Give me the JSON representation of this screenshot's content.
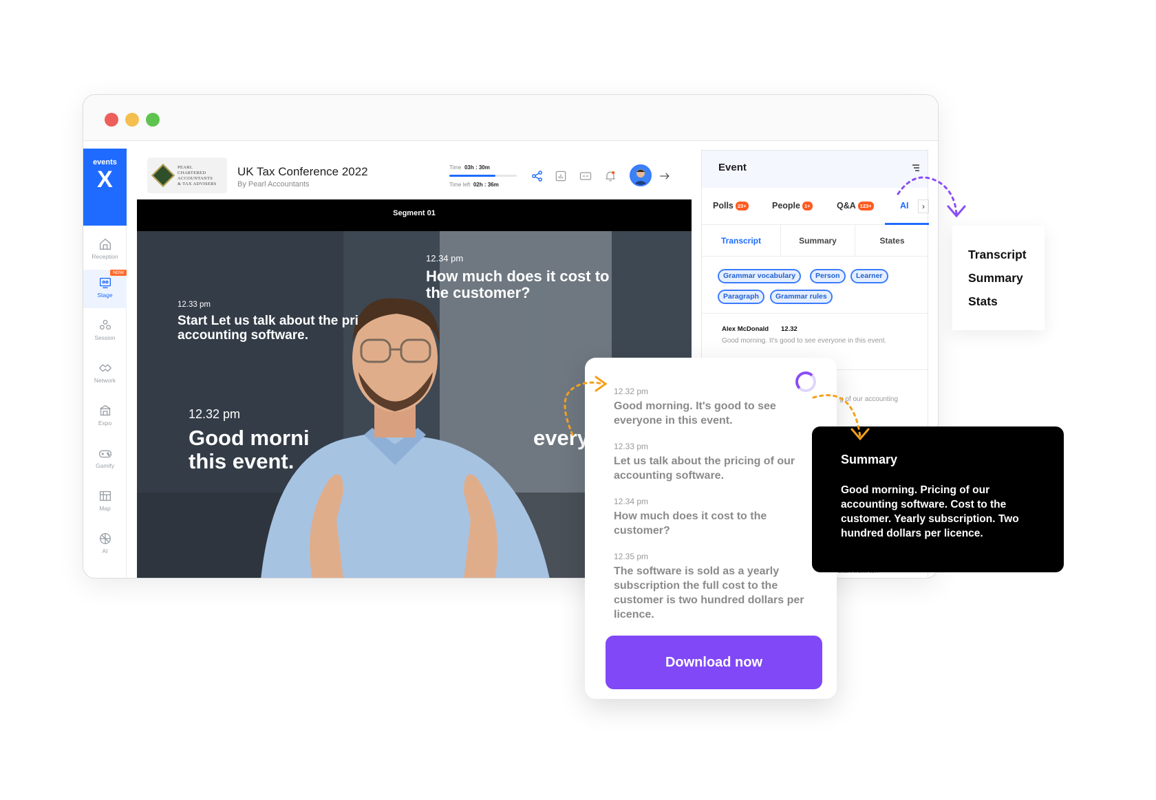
{
  "window": {
    "traffic_lights": [
      "close",
      "minimize",
      "zoom"
    ]
  },
  "sidebar": {
    "brand_word": "events",
    "brand_mark": "X",
    "items": [
      {
        "label": "Reception",
        "icon": "home-icon"
      },
      {
        "label": "Stage",
        "icon": "stage-icon",
        "badge": "NOW",
        "active": true
      },
      {
        "label": "Session",
        "icon": "session-icon"
      },
      {
        "label": "Network",
        "icon": "network-icon"
      },
      {
        "label": "Expo",
        "icon": "expo-icon"
      },
      {
        "label": "Gamify",
        "icon": "gamify-icon"
      },
      {
        "label": "Map",
        "icon": "map-icon"
      },
      {
        "label": "AI",
        "icon": "ai-icon"
      }
    ]
  },
  "header": {
    "logo_lines": [
      "PEARL",
      "CHARTERED",
      "ACCOUNTANTS",
      "& TAX ADVISERS"
    ],
    "title": "UK Tax Conference 2022",
    "subtitle": "By Pearl Accountants",
    "time_label": "Time",
    "time_value": "03h : 30m",
    "time_left_label": "Time left",
    "time_left_value": "02h : 36m",
    "time_progress": 0.68
  },
  "video": {
    "segment": "Segment 01",
    "captions": [
      {
        "time": "12.34 pm",
        "text": "How much does it cost to the customer?"
      },
      {
        "time": "12.33 pm",
        "text": "Start Let us talk about the pri accounting software."
      },
      {
        "time": "12.32 pm",
        "text": "Good morni this event."
      },
      {
        "fragment": "every"
      }
    ]
  },
  "panel": {
    "title": "Event",
    "tabs": [
      {
        "label": "Polls",
        "badge": "23+"
      },
      {
        "label": "People",
        "badge": "1+"
      },
      {
        "label": "Q&A",
        "badge": "123+"
      },
      {
        "label": "AI",
        "active": true
      }
    ],
    "subtabs": [
      "Transcript",
      "Summary",
      "States"
    ],
    "chips": [
      "Grammar vocabulary",
      "Person",
      "Learner",
      "Paragraph",
      "Grammar rules"
    ],
    "entry": {
      "name": "Alex McDonald",
      "time": "12.32",
      "text": "Good morning. It's good to see everyone in this event."
    },
    "fragments": [
      "g of our accounting",
      "start from ten"
    ]
  },
  "transcript_card": {
    "entries": [
      {
        "time": "12.32 pm",
        "text": "Good morning. It's good to see everyone in this event."
      },
      {
        "time": "12.33 pm",
        "text": "Let us talk about the pricing of our accounting software."
      },
      {
        "time": "12.34 pm",
        "text": "How much does it cost to the customer?"
      },
      {
        "time": "12.35 pm",
        "text": "The software is sold as a yearly subscription the full cost to the customer is two hundred dollars per licence."
      }
    ],
    "download_label": "Download now"
  },
  "summary_card": {
    "title": "Summary",
    "text": "Good morning. Pricing of our accounting software. Cost to the customer. Yearly subscription. Two hundred dollars per licence."
  },
  "menu_card": {
    "items": [
      "Transcript",
      "Summary",
      "Stats"
    ]
  },
  "colors": {
    "brand_blue": "#1f6bff",
    "accent_purple": "#8048f6",
    "badge_orange": "#ff5a1f",
    "arrow_orange": "#f5a01a",
    "arrow_purple": "#8a4cf5"
  }
}
